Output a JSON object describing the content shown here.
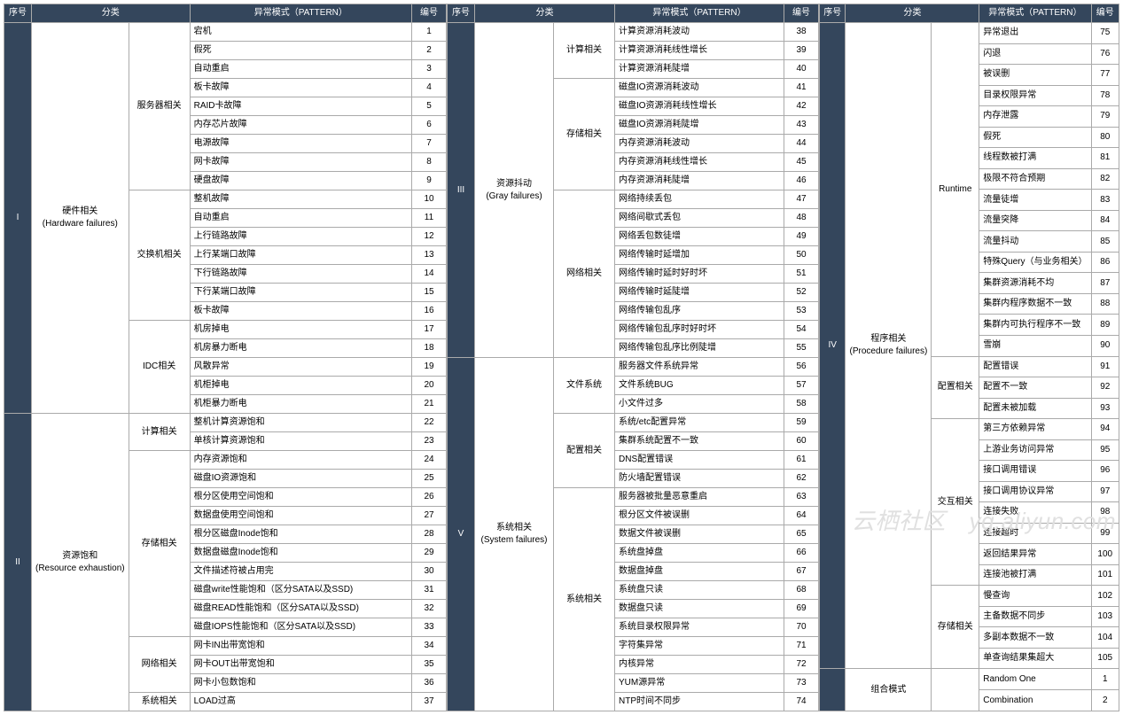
{
  "headers": {
    "seq": "序号",
    "cat": "分类",
    "pat": "异常模式（PATTERN）",
    "num": "编号"
  },
  "watermark": "云栖社区　yq.aliyun.com",
  "groups": [
    {
      "seq": "I",
      "cat": [
        "硬件相关",
        "(Hardware failures)"
      ],
      "subs": [
        {
          "cat": "服务器相关",
          "rows": [
            [
              "宕机",
              "1"
            ],
            [
              "假死",
              "2"
            ],
            [
              "自动重启",
              "3"
            ],
            [
              "板卡故障",
              "4"
            ],
            [
              "RAID卡故障",
              "5"
            ],
            [
              "内存芯片故障",
              "6"
            ],
            [
              "电源故障",
              "7"
            ],
            [
              "网卡故障",
              "8"
            ],
            [
              "硬盘故障",
              "9"
            ]
          ]
        },
        {
          "cat": "交换机相关",
          "rows": [
            [
              "整机故障",
              "10"
            ],
            [
              "自动重启",
              "11"
            ],
            [
              "上行链路故障",
              "12"
            ],
            [
              "上行某端口故障",
              "13"
            ],
            [
              "下行链路故障",
              "14"
            ],
            [
              "下行某端口故障",
              "15"
            ],
            [
              "板卡故障",
              "16"
            ]
          ]
        },
        {
          "cat": "IDC相关",
          "rows": [
            [
              "机房掉电",
              "17"
            ],
            [
              "机房暴力断电",
              "18"
            ],
            [
              "风散异常",
              "19"
            ],
            [
              "机柜掉电",
              "20"
            ],
            [
              "机柜暴力断电",
              "21"
            ]
          ]
        }
      ]
    },
    {
      "seq": "II",
      "cat": [
        "资源饱和",
        "(Resource exhaustion)"
      ],
      "subs": [
        {
          "cat": "计算相关",
          "rows": [
            [
              "整机计算资源饱和",
              "22"
            ],
            [
              "单核计算资源饱和",
              "23"
            ]
          ]
        },
        {
          "cat": "存储相关",
          "rows": [
            [
              "内存资源饱和",
              "24"
            ],
            [
              "磁盘IO资源饱和",
              "25"
            ],
            [
              "根分区使用空间饱和",
              "26"
            ],
            [
              "数据盘使用空间饱和",
              "27"
            ],
            [
              "根分区磁盘Inode饱和",
              "28"
            ],
            [
              "数据盘磁盘Inode饱和",
              "29"
            ],
            [
              "文件描述符被占用完",
              "30"
            ],
            [
              "磁盘write性能饱和（区分SATA以及SSD)",
              "31"
            ],
            [
              "磁盘READ性能饱和（区分SATA以及SSD)",
              "32"
            ],
            [
              "磁盘IOPS性能饱和（区分SATA以及SSD)",
              "33"
            ]
          ]
        },
        {
          "cat": "网络相关",
          "rows": [
            [
              "网卡IN出带宽饱和",
              "34"
            ],
            [
              "网卡OUT出带宽饱和",
              "35"
            ],
            [
              "网卡小包数饱和",
              "36"
            ]
          ]
        },
        {
          "cat": "系统相关",
          "rows": [
            [
              "LOAD过高",
              "37"
            ]
          ]
        }
      ]
    },
    {
      "seq": "III",
      "cat": [
        "资源抖动",
        "(Gray failures)"
      ],
      "subs": [
        {
          "cat": "计算相关",
          "rows": [
            [
              "计算资源消耗波动",
              "38"
            ],
            [
              "计算资源消耗线性增长",
              "39"
            ],
            [
              "计算资源消耗陡增",
              "40"
            ]
          ]
        },
        {
          "cat": "存储相关",
          "rows": [
            [
              "磁盘IO资源消耗波动",
              "41"
            ],
            [
              "磁盘IO资源消耗线性增长",
              "42"
            ],
            [
              "磁盘IO资源消耗陡增",
              "43"
            ],
            [
              "内存资源消耗波动",
              "44"
            ],
            [
              "内存资源消耗线性增长",
              "45"
            ],
            [
              "内存资源消耗陡增",
              "46"
            ]
          ]
        },
        {
          "cat": "网络相关",
          "rows": [
            [
              "网络持续丢包",
              "47"
            ],
            [
              "网络间歇式丢包",
              "48"
            ],
            [
              "网络丢包数徒增",
              "49"
            ],
            [
              "网络传输时延增加",
              "50"
            ],
            [
              "网络传输时延时好时坏",
              "51"
            ],
            [
              "网络传输时延陡增",
              "52"
            ],
            [
              "网络传输包乱序",
              "53"
            ],
            [
              "网络传输包乱序时好时坏",
              "54"
            ],
            [
              "网络传输包乱序比例陡增",
              "55"
            ]
          ]
        }
      ]
    },
    {
      "seq": "V",
      "cat": [
        "系统相关",
        "(System failures)"
      ],
      "subs": [
        {
          "cat": "文件系统",
          "rows": [
            [
              "服务器文件系统异常",
              "56"
            ],
            [
              "文件系统BUG",
              "57"
            ],
            [
              "小文件过多",
              "58"
            ]
          ]
        },
        {
          "cat": "配置相关",
          "rows": [
            [
              "系统/etc配置异常",
              "59"
            ],
            [
              "集群系统配置不一致",
              "60"
            ],
            [
              "DNS配置错误",
              "61"
            ],
            [
              "防火墙配置错误",
              "62"
            ]
          ]
        },
        {
          "cat": "系统相关",
          "rows": [
            [
              "服务器被批量恶意重启",
              "63"
            ],
            [
              "根分区文件被误删",
              "64"
            ],
            [
              "数据文件被误删",
              "65"
            ],
            [
              "系统盘掉盘",
              "66"
            ],
            [
              "数据盘掉盘",
              "67"
            ],
            [
              "系统盘只读",
              "68"
            ],
            [
              "数据盘只读",
              "69"
            ],
            [
              "系统目录权限异常",
              "70"
            ],
            [
              "字符集异常",
              "71"
            ],
            [
              "内核异常",
              "72"
            ],
            [
              "YUM源异常",
              "73"
            ],
            [
              "NTP时间不同步",
              "74"
            ]
          ]
        }
      ]
    },
    {
      "seq": "IV",
      "cat": [
        "程序相关",
        "(Procedure failures)"
      ],
      "subs": [
        {
          "cat": "Runtime",
          "rows": [
            [
              "异常退出",
              "75"
            ],
            [
              "闪退",
              "76"
            ],
            [
              "被误删",
              "77"
            ],
            [
              "目录权限异常",
              "78"
            ],
            [
              "内存泄露",
              "79"
            ],
            [
              "假死",
              "80"
            ],
            [
              "线程数被打满",
              "81"
            ],
            [
              "极限不符合预期",
              "82"
            ],
            [
              "流量徒增",
              "83"
            ],
            [
              "流量突降",
              "84"
            ],
            [
              "流量抖动",
              "85"
            ],
            [
              "特殊Query（与业务相关）",
              "86"
            ],
            [
              "集群资源消耗不均",
              "87"
            ],
            [
              "集群内程序数据不一致",
              "88"
            ],
            [
              "集群内可执行程序不一致",
              "89"
            ],
            [
              "雪崩",
              "90"
            ]
          ]
        },
        {
          "cat": "配置相关",
          "rows": [
            [
              "配置错误",
              "91"
            ],
            [
              "配置不一致",
              "92"
            ],
            [
              "配置未被加载",
              "93"
            ]
          ]
        },
        {
          "cat": "交互相关",
          "rows": [
            [
              "第三方依赖异常",
              "94"
            ],
            [
              "上游业务访问异常",
              "95"
            ],
            [
              "接口调用错误",
              "96"
            ],
            [
              "接口调用协议异常",
              "97"
            ],
            [
              "连接失败",
              "98"
            ],
            [
              "连接超时",
              "99"
            ],
            [
              "返回结果异常",
              "100"
            ],
            [
              "连接池被打满",
              "101"
            ]
          ]
        },
        {
          "cat": "存储相关",
          "rows": [
            [
              "慢查询",
              "102"
            ],
            [
              "主备数据不同步",
              "103"
            ],
            [
              "多副本数据不一致",
              "104"
            ],
            [
              "单查询结果集超大",
              "105"
            ]
          ]
        }
      ]
    },
    {
      "seq": "",
      "cat": [
        "组合模式"
      ],
      "subs": [
        {
          "cat": "",
          "rows": [
            [
              "Random One",
              "1"
            ],
            [
              "Combination",
              "2"
            ]
          ]
        }
      ]
    }
  ]
}
